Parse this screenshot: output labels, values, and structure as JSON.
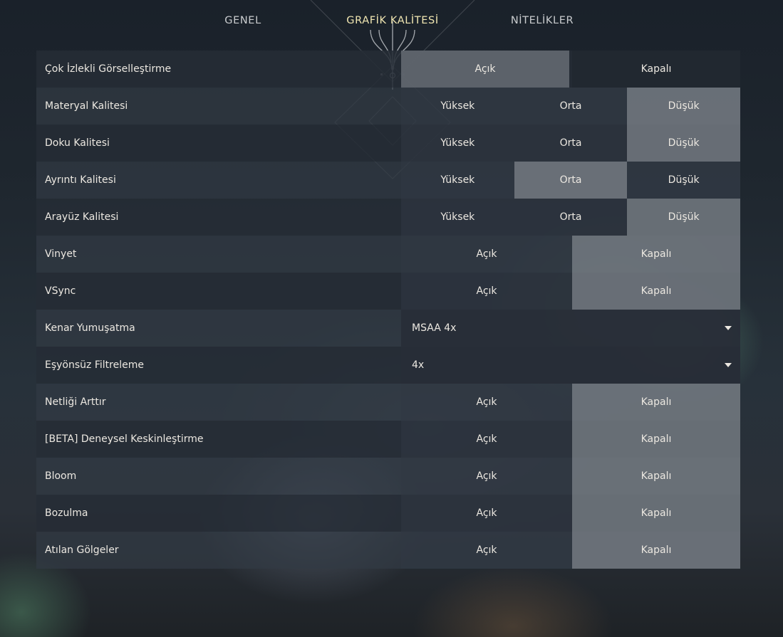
{
  "tabs": [
    {
      "label": "GENEL"
    },
    {
      "label": "GRAFİK KALİTESİ"
    },
    {
      "label": "NİTELİKLER"
    }
  ],
  "active_tab_color": "#f1e7b2",
  "selected_color": "#767c84",
  "settings": [
    {
      "label": "Çok İzlekli Görselleştirme",
      "options": [
        "Açık",
        "Kapalı"
      ],
      "selected": "Açık"
    },
    {
      "label": "Materyal Kalitesi",
      "options": [
        "Yüksek",
        "Orta",
        "Düşük"
      ],
      "selected": "Düşük"
    },
    {
      "label": "Doku Kalitesi",
      "options": [
        "Yüksek",
        "Orta",
        "Düşük"
      ],
      "selected": "Düşük"
    },
    {
      "label": "Ayrıntı Kalitesi",
      "options": [
        "Yüksek",
        "Orta",
        "Düşük"
      ],
      "selected": "Orta"
    },
    {
      "label": "Arayüz Kalitesi",
      "options": [
        "Yüksek",
        "Orta",
        "Düşük"
      ],
      "selected": "Düşük"
    },
    {
      "label": "Vinyet",
      "options": [
        "Açık",
        "Kapalı"
      ],
      "selected": "Kapalı"
    },
    {
      "label": "VSync",
      "options": [
        "Açık",
        "Kapalı"
      ],
      "selected": "Kapalı"
    },
    {
      "label": "Kenar Yumuşatma",
      "value": "MSAA 4x"
    },
    {
      "label": "Eşyönsüz Filtreleme",
      "value": "4x"
    },
    {
      "label": "Netliği Arttır",
      "options": [
        "Açık",
        "Kapalı"
      ],
      "selected": "Kapalı"
    },
    {
      "label": "[BETA] Deneysel Keskinleştirme",
      "options": [
        "Açık",
        "Kapalı"
      ],
      "selected": "Kapalı"
    },
    {
      "label": "Bloom",
      "options": [
        "Açık",
        "Kapalı"
      ],
      "selected": "Kapalı"
    },
    {
      "label": "Bozulma",
      "options": [
        "Açık",
        "Kapalı"
      ],
      "selected": "Kapalı"
    },
    {
      "label": "Atılan Gölgeler",
      "options": [
        "Açık",
        "Kapalı"
      ],
      "selected": "Kapalı"
    }
  ]
}
